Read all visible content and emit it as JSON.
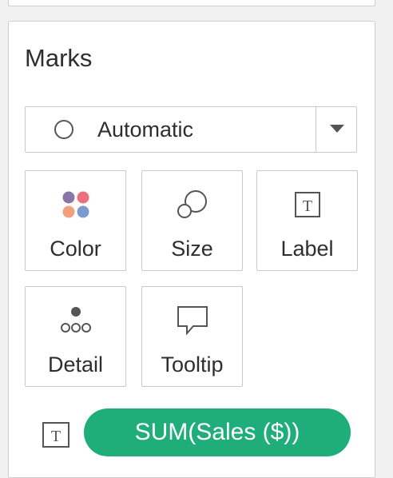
{
  "marks": {
    "title": "Marks",
    "mark_type": {
      "selected": "Automatic",
      "icon": "circle-outline-icon"
    },
    "buttons": [
      {
        "label": "Color",
        "icon": "color-dots-icon"
      },
      {
        "label": "Size",
        "icon": "size-circles-icon"
      },
      {
        "label": "Label",
        "icon": "text-label-icon"
      },
      {
        "label": "Detail",
        "icon": "detail-dots-icon"
      },
      {
        "label": "Tooltip",
        "icon": "tooltip-speech-icon"
      }
    ],
    "fields": [
      {
        "type_icon": "text-label-icon",
        "pill_label": "SUM(Sales ($))"
      }
    ]
  },
  "colors": {
    "pill_green": "#1fae7a",
    "dot_purple": "#8a76a6",
    "dot_pink": "#ec6f7e",
    "dot_orange": "#f0a07a",
    "dot_blue": "#7b9bd0"
  }
}
